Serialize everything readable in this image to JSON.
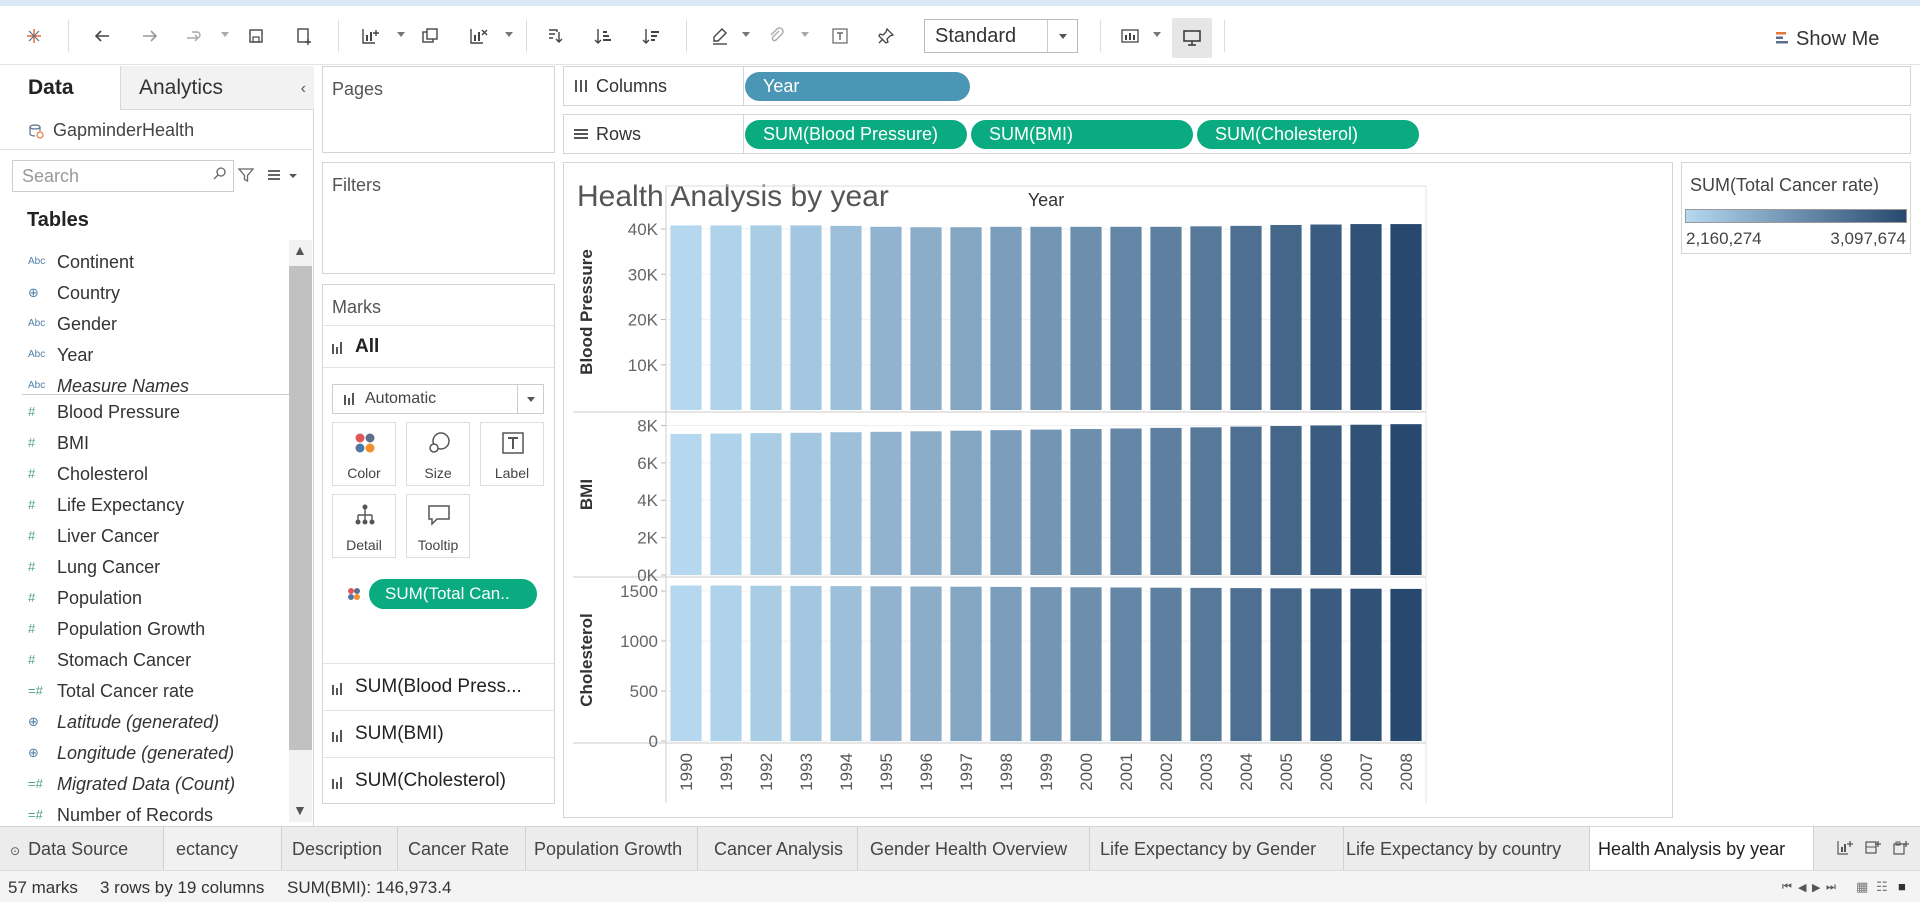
{
  "toolbar": {
    "view_size": "Standard",
    "show_me": "Show Me"
  },
  "data_pane": {
    "tab_data": "Data",
    "tab_analytics": "Analytics",
    "datasource": "GapminderHealth",
    "search_placeholder": "Search",
    "tables_heading": "Tables",
    "dimensions": [
      {
        "name": "Continent",
        "type": "Abc",
        "italic": false
      },
      {
        "name": "Country",
        "type": "globe",
        "italic": false
      },
      {
        "name": "Gender",
        "type": "Abc",
        "italic": false
      },
      {
        "name": "Year",
        "type": "Abc",
        "italic": false
      },
      {
        "name": "Measure Names",
        "type": "Abc",
        "italic": true
      }
    ],
    "measures": [
      {
        "name": "Blood Pressure",
        "type": "#",
        "italic": false
      },
      {
        "name": "BMI",
        "type": "#",
        "italic": false
      },
      {
        "name": "Cholesterol",
        "type": "#",
        "italic": false
      },
      {
        "name": "Life Expectancy",
        "type": "#",
        "italic": false
      },
      {
        "name": "Liver Cancer",
        "type": "#",
        "italic": false
      },
      {
        "name": "Lung Cancer",
        "type": "#",
        "italic": false
      },
      {
        "name": "Population",
        "type": "#",
        "italic": false
      },
      {
        "name": "Population Growth",
        "type": "#",
        "italic": false
      },
      {
        "name": "Stomach Cancer",
        "type": "#",
        "italic": false
      },
      {
        "name": "Total Cancer rate",
        "type": "=#",
        "italic": false
      },
      {
        "name": "Latitude (generated)",
        "type": "globe",
        "italic": true
      },
      {
        "name": "Longitude (generated)",
        "type": "globe",
        "italic": true
      },
      {
        "name": "Migrated Data (Count)",
        "type": "=#",
        "italic": true
      },
      {
        "name": "Number of Records",
        "type": "=#",
        "italic": false
      }
    ]
  },
  "cards": {
    "pages": "Pages",
    "filters": "Filters",
    "marks": "Marks",
    "marks_all": "All",
    "mark_type": "Automatic",
    "buttons": {
      "color": "Color",
      "size": "Size",
      "label": "Label",
      "detail": "Detail",
      "tooltip": "Tooltip"
    },
    "color_pill": "SUM(Total Can..",
    "mark_rows": [
      "SUM(Blood Press...",
      "SUM(BMI)",
      "SUM(Cholesterol)"
    ]
  },
  "shelves": {
    "columns_label": "Columns",
    "rows_label": "Rows",
    "columns_pills": [
      "Year"
    ],
    "rows_pills": [
      "SUM(Blood Pressure)",
      "SUM(BMI)",
      "SUM(Cholesterol)"
    ]
  },
  "view": {
    "title": "Health Analysis by year"
  },
  "legend": {
    "title": "SUM(Total Cancer rate)",
    "min": "2,160,274",
    "max": "3,097,674",
    "color_low": "#b5d8f0",
    "color_high": "#27496f"
  },
  "chart_data": {
    "type": "bar",
    "x_header": "Year",
    "categories": [
      "1990",
      "1991",
      "1992",
      "1993",
      "1994",
      "1995",
      "1996",
      "1997",
      "1998",
      "1999",
      "2000",
      "2001",
      "2002",
      "2003",
      "2004",
      "2005",
      "2006",
      "2007",
      "2008"
    ],
    "color_values": [
      2160274,
      2190000,
      2230000,
      2270000,
      2320000,
      2400000,
      2440000,
      2490000,
      2540000,
      2590000,
      2640000,
      2690000,
      2740000,
      2790000,
      2850000,
      2910000,
      2970000,
      3040000,
      3097674
    ],
    "panes": [
      {
        "ylabel": "Blood Pressure",
        "ylim": [
          0,
          42000
        ],
        "ticks": [
          10000,
          20000,
          30000,
          40000
        ],
        "tick_labels": [
          "10K",
          "20K",
          "30K",
          "40K"
        ],
        "values": [
          40800,
          40800,
          40800,
          40800,
          40700,
          40500,
          40400,
          40400,
          40500,
          40500,
          40500,
          40500,
          40500,
          40600,
          40700,
          40900,
          41000,
          41100,
          41100
        ]
      },
      {
        "ylabel": "BMI",
        "ylim": [
          0,
          8400
        ],
        "ticks": [
          0,
          2000,
          4000,
          6000,
          8000
        ],
        "tick_labels": [
          "0K",
          "2K",
          "4K",
          "6K",
          "8K"
        ],
        "values": [
          7550,
          7570,
          7590,
          7610,
          7640,
          7660,
          7690,
          7720,
          7750,
          7780,
          7810,
          7840,
          7870,
          7900,
          7940,
          7970,
          8000,
          8040,
          8070
        ]
      },
      {
        "ylabel": "Cholesterol",
        "ylim": [
          0,
          1580
        ],
        "ticks": [
          0,
          500,
          1000,
          1500
        ],
        "tick_labels": [
          "0",
          "500",
          "1000",
          "1500"
        ],
        "values": [
          1555,
          1555,
          1553,
          1551,
          1549,
          1547,
          1545,
          1543,
          1541,
          1539,
          1537,
          1535,
          1533,
          1531,
          1529,
          1527,
          1525,
          1523,
          1521
        ]
      }
    ]
  },
  "sheet_tabs": {
    "data_source": "Data Source",
    "tabs": [
      "ectancy",
      "Description",
      "Cancer Rate",
      "Population Growth",
      "Cancer Analysis",
      "Gender Health Overview",
      "Life Expectancy by Gender",
      "Life Expectancy by country",
      "Health Analysis by year"
    ],
    "active": "Health Analysis by year"
  },
  "status": {
    "marks": "57 marks",
    "dims": "3 rows by 19 columns",
    "sum": "SUM(BMI): 146,973.4"
  }
}
